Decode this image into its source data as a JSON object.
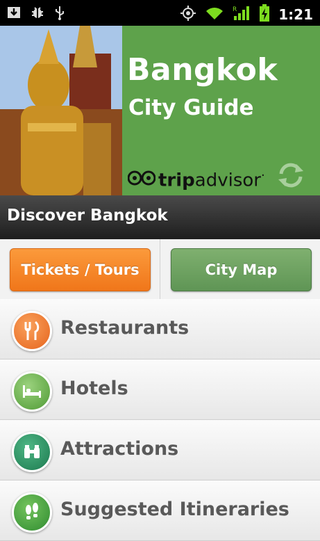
{
  "status_bar": {
    "time": "1:21",
    "left_icons": [
      "download-icon",
      "android-debug-icon",
      "usb-icon"
    ],
    "right_icons": [
      "gps-icon",
      "wifi-icon",
      "signal-roaming-icon",
      "battery-charging-icon"
    ]
  },
  "hero": {
    "title": "Bangkok",
    "subtitle": "City Guide",
    "brand_part1": "trip",
    "brand_part2": "advisor",
    "brand_mark": "·",
    "colors": {
      "panel": "#5ea24b"
    }
  },
  "section_header": {
    "title": "Discover Bangkok"
  },
  "buttons": {
    "tickets_label": "Tickets / Tours",
    "map_label": "City Map",
    "colors": {
      "tickets": "#f07a1c",
      "map": "#6aa15e"
    }
  },
  "menu": {
    "items": [
      {
        "label": "Restaurants",
        "icon": "fork-knife-icon",
        "color": "#f0762a"
      },
      {
        "label": "Hotels",
        "icon": "bed-icon",
        "color": "#5fa244"
      },
      {
        "label": "Attractions",
        "icon": "binoculars-icon",
        "color": "#1f8a5a"
      },
      {
        "label": "Suggested Itineraries",
        "icon": "footprints-icon",
        "color": "#3c9c3f"
      }
    ]
  }
}
